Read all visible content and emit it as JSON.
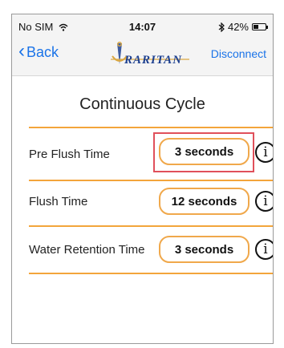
{
  "status_bar": {
    "carrier": "No SIM",
    "wifi_icon": "wifi-icon",
    "time": "14:07",
    "bluetooth_icon": "bluetooth-icon",
    "battery_percent": "42%",
    "battery_level": 0.42
  },
  "nav": {
    "back_label": "Back",
    "logo_text": "RARITAN",
    "disconnect_label": "Disconnect"
  },
  "page": {
    "title": "Continuous Cycle"
  },
  "rows": [
    {
      "label": "Pre Flush Time",
      "value": "3 seconds",
      "highlighted": true
    },
    {
      "label": "Flush Time",
      "value": "12 seconds",
      "highlighted": false
    },
    {
      "label": "Water Retention Time",
      "value": "3 seconds",
      "highlighted": false
    }
  ],
  "info_glyph": "i",
  "colors": {
    "accent": "#f3a53b",
    "link": "#1a73e8",
    "highlight": "#e0505b",
    "logo_blue": "#1c3f8f",
    "logo_gold": "#d9a640"
  }
}
